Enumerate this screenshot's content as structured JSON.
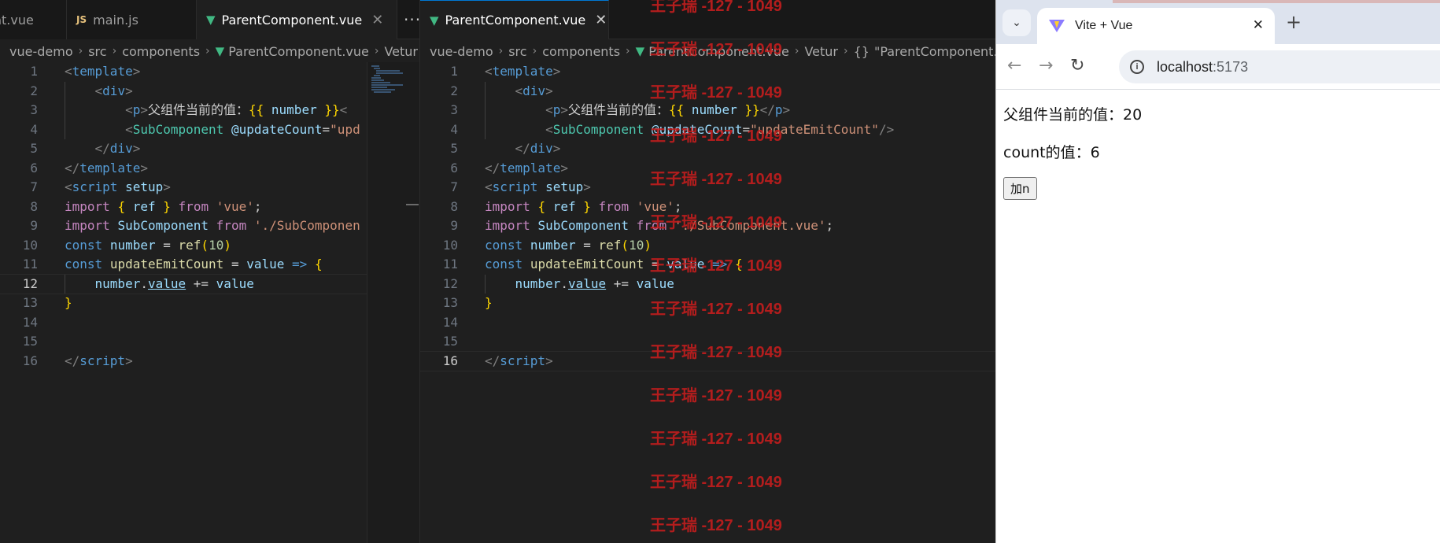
{
  "left_editor": {
    "tabs": [
      {
        "label": "ent.vue"
      },
      {
        "label": "main.js",
        "icon": "js-file-icon"
      },
      {
        "label": "ParentComponent.vue",
        "icon": "vue-file-icon"
      }
    ],
    "breadcrumb": [
      "vue-demo",
      "src",
      "components",
      "ParentComponent.vue",
      "Vetur"
    ]
  },
  "right_editor": {
    "tabs": [
      {
        "label": "ParentComponent.vue",
        "icon": "vue-file-icon"
      }
    ],
    "breadcrumb": [
      "vue-demo",
      "src",
      "components",
      "ParentComponent.vue",
      "Vetur",
      "\"ParentComponent.vu"
    ],
    "breadcrumb_braces": "{}"
  },
  "tab_close_glyph": "✕",
  "more_actions_glyph": "···",
  "breadcrumb_separator": "›",
  "code_lines": [
    "1",
    "2",
    "3",
    "4",
    "5",
    "6",
    "7",
    "8",
    "9",
    "10",
    "11",
    "12",
    "13",
    "14",
    "15",
    "16"
  ],
  "left_active_line": "12",
  "right_active_line": "16",
  "watermark": {
    "text": "王子瑞 -127 - 1049",
    "color": "#c81e1e"
  },
  "browser": {
    "tab_title": "Vite + Vue",
    "new_tab_glyph": "+",
    "menu_glyph": "⌄",
    "back_glyph": "←",
    "forward_glyph": "→",
    "reload_glyph": "↻",
    "info_glyph": "i",
    "url_host": "localhost",
    "url_port": ":5173",
    "parent_label": "父组件当前的值：20",
    "count_label": "count的值：6",
    "button_label": "加n"
  },
  "colors": {
    "editor_bg": "#1f1f1f",
    "tag": "#569cd6",
    "string": "#ce9178",
    "vue_green": "#41b883",
    "browser_chrome": "#dde3ee"
  }
}
